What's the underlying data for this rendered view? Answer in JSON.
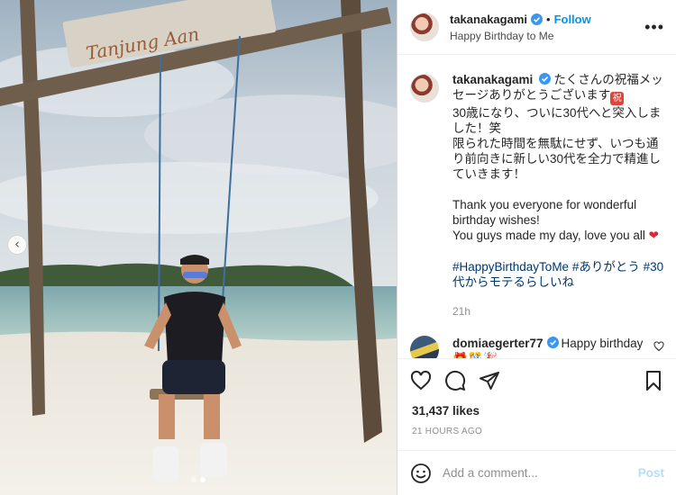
{
  "post": {
    "sign_text": "Tanjung Aan",
    "carousel": {
      "slides": 2,
      "active": 1
    }
  },
  "header": {
    "username": "takanakagami",
    "separator": "•",
    "follow_label": "Follow",
    "subtitle": "Happy Birthday to Me",
    "more_label": "•••"
  },
  "caption": {
    "username": "takanakagami",
    "line_ja_1": "たくさんの祝福メッセージありがとうございます",
    "stamp_char": "祝",
    "line_ja_2": "30歳になり、ついに30代へと突入しました！笑\n限られた時間を無駄にせず、いつも通り前向きに新しい30代を全力で精進していきます！",
    "line_en_1": "Thank you everyone for wonderful birthday wishes!\nYou guys made my day, love you all",
    "heart_emoji": "❤",
    "hashtags": "#HappyBirthdayToMe #ありがとう #30代からモテるらしいね",
    "time": "21h"
  },
  "comment": {
    "username": "domiaegerter77",
    "text": "Happy birthday 🎁🎊🎉"
  },
  "stats": {
    "likes": "31,437 likes",
    "posted_ago": "21 HOURS AGO"
  },
  "composer": {
    "placeholder": "Add a comment...",
    "post_label": "Post"
  },
  "colors": {
    "accent": "#0095f6",
    "hashtag": "#00376b",
    "muted": "#8e8e8e",
    "post_disabled": "#b2dffc",
    "verified": "#3897f0"
  },
  "icons": [
    "chevron-left-icon",
    "verified-badge-icon",
    "more-icon",
    "heart-icon",
    "comment-icon",
    "share-icon",
    "bookmark-icon",
    "emoji-icon"
  ]
}
